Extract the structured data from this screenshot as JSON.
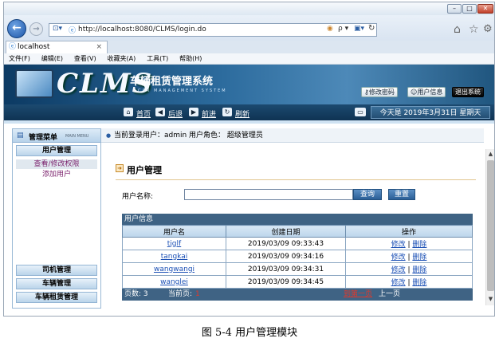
{
  "window": {
    "min": "–",
    "max": "□",
    "close": "✕"
  },
  "address": {
    "url": "http://localhost:8080/CLMS/login.do",
    "search_icon": "ρ ▾"
  },
  "tab": {
    "title": "localhost",
    "close": "×"
  },
  "menu": [
    "文件(F)",
    "编辑(E)",
    "查看(V)",
    "收藏夹(A)",
    "工具(T)",
    "帮助(H)"
  ],
  "banner": {
    "logo": "CLMS",
    "system_name": "车辆租赁管理系统",
    "system_name_en": "CAR MANAGEMENT SYSTEM",
    "btn_change_pwd": "修改密码",
    "btn_user_info": "用户信息",
    "btn_logout": "退出系统"
  },
  "toolbar": {
    "home": "首页",
    "back": "后退",
    "forward": "前进",
    "refresh": "刷新",
    "date": "今天是 2019年3月31日 星期天"
  },
  "sidebar": {
    "title": "管理菜单",
    "title_en": "MAIN MENU",
    "groups": {
      "user": "用户管理",
      "driver": "司机管理",
      "vehicle": "车辆管理",
      "rental": "车辆租赁管理"
    },
    "items": [
      "查看/修改权限",
      "添加用户"
    ]
  },
  "main": {
    "userbar": "当前登录用户：admin  用户角色：  超级管理员",
    "section_title": "用户管理",
    "search_label": "用户名称:",
    "search_value": "",
    "btn_query": "查询",
    "btn_reset": "重置",
    "table_caption": "用户信息",
    "columns": [
      "用户名",
      "创建日期",
      "操作"
    ],
    "rows": [
      {
        "name": "tjglf",
        "date": "2019/03/09 09:33:43"
      },
      {
        "name": "tangkai",
        "date": "2019/03/09 09:34:16"
      },
      {
        "name": "wangwangi",
        "date": "2019/03/09 09:34:31"
      },
      {
        "name": "wanglei",
        "date": "2019/03/09 09:34:45"
      }
    ],
    "op_edit": "修改",
    "op_sep": "|",
    "op_delete": "删除",
    "pager": {
      "total": "页数: 3",
      "current_label": "当前页:",
      "current": "1",
      "first": "到第一页",
      "prev": "上一页"
    }
  },
  "caption": "图 5-4  用户管理模块"
}
